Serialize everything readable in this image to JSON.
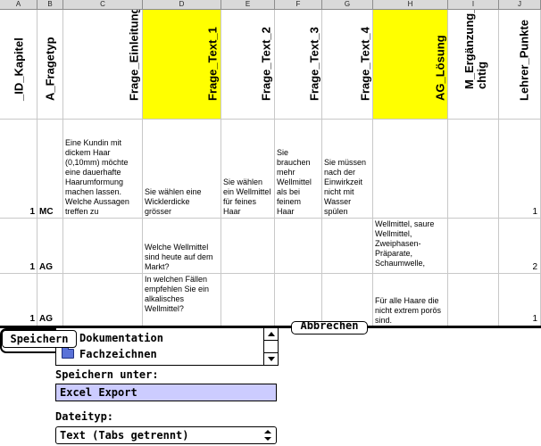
{
  "spreadsheet": {
    "column_letters": [
      "A",
      "B",
      "C",
      "D",
      "E",
      "F",
      "G",
      "H",
      "I",
      "J"
    ],
    "headers": [
      {
        "label": "_ID_Kapitel",
        "highlight": false
      },
      {
        "label": "A_Fragetyp",
        "highlight": false
      },
      {
        "label": "Frage_Einleitung",
        "highlight": false
      },
      {
        "label": "Frage_Text_1",
        "highlight": true
      },
      {
        "label": "Frage_Text_2",
        "highlight": false
      },
      {
        "label": "Frage_Text_3",
        "highlight": false
      },
      {
        "label": "Frage_Text_4",
        "highlight": false
      },
      {
        "label": "AG_Lösung",
        "highlight": true
      },
      {
        "label": "M_Ergänzung_Ri\nchtig",
        "highlight": false
      },
      {
        "label": "Lehrer_Punkte",
        "highlight": false
      }
    ],
    "highlight_color": "#ffff00",
    "rows": [
      {
        "id_kapitel": "1",
        "fragetyp": "MC",
        "einleitung": "Eine Kundin mit dickem Haar (0,10mm) möchte eine dauerhafte Haarumformung machen lassen. Welche Aussagen treffen zu",
        "text1": "Sie wählen eine Wicklerdicke grösser",
        "text2": "Sie wählen ein Wellmittel für feines Haar",
        "text3": "Sie brauchen mehr Wellmittel als bei feinem Haar",
        "text4": "Sie müssen nach der Einwirkzeit nicht mit Wasser spülen",
        "loesung": "",
        "ergaenzung": "",
        "punkte": "1"
      },
      {
        "id_kapitel": "1",
        "fragetyp": "AG",
        "einleitung": "",
        "text1": "Welche Wellmittel sind heute auf dem Markt?",
        "text2": "",
        "text3": "",
        "text4": "",
        "loesung": "Wellmittel, saure Wellmittel, Zweiphasen-Präparate, Schaumwelle,",
        "ergaenzung": "",
        "punkte": "2"
      },
      {
        "id_kapitel": "1",
        "fragetyp": "AG",
        "einleitung": "",
        "text1": "In welchen Fällen empfehlen Sie ein alkalisches Wellmittel?",
        "text2": "",
        "text3": "",
        "text4": "",
        "loesung": "Für alle Haare die nicht extrem porös sind.",
        "ergaenzung": "",
        "punkte": "1"
      }
    ]
  },
  "dialog": {
    "list_items": [
      {
        "label": "Dokumentation",
        "icon": "folder-icon"
      },
      {
        "label": "Fachzeichnen",
        "icon": "folder-icon"
      }
    ],
    "cancel_label": "Abbrechen",
    "save_label": "Speichern",
    "save_as_label": "Speichern unter:",
    "filename_value": "Excel Export",
    "filename_highlight": "#ccccff",
    "filetype_label": "Dateityp:",
    "filetype_value": "Text (Tabs getrennt)"
  }
}
